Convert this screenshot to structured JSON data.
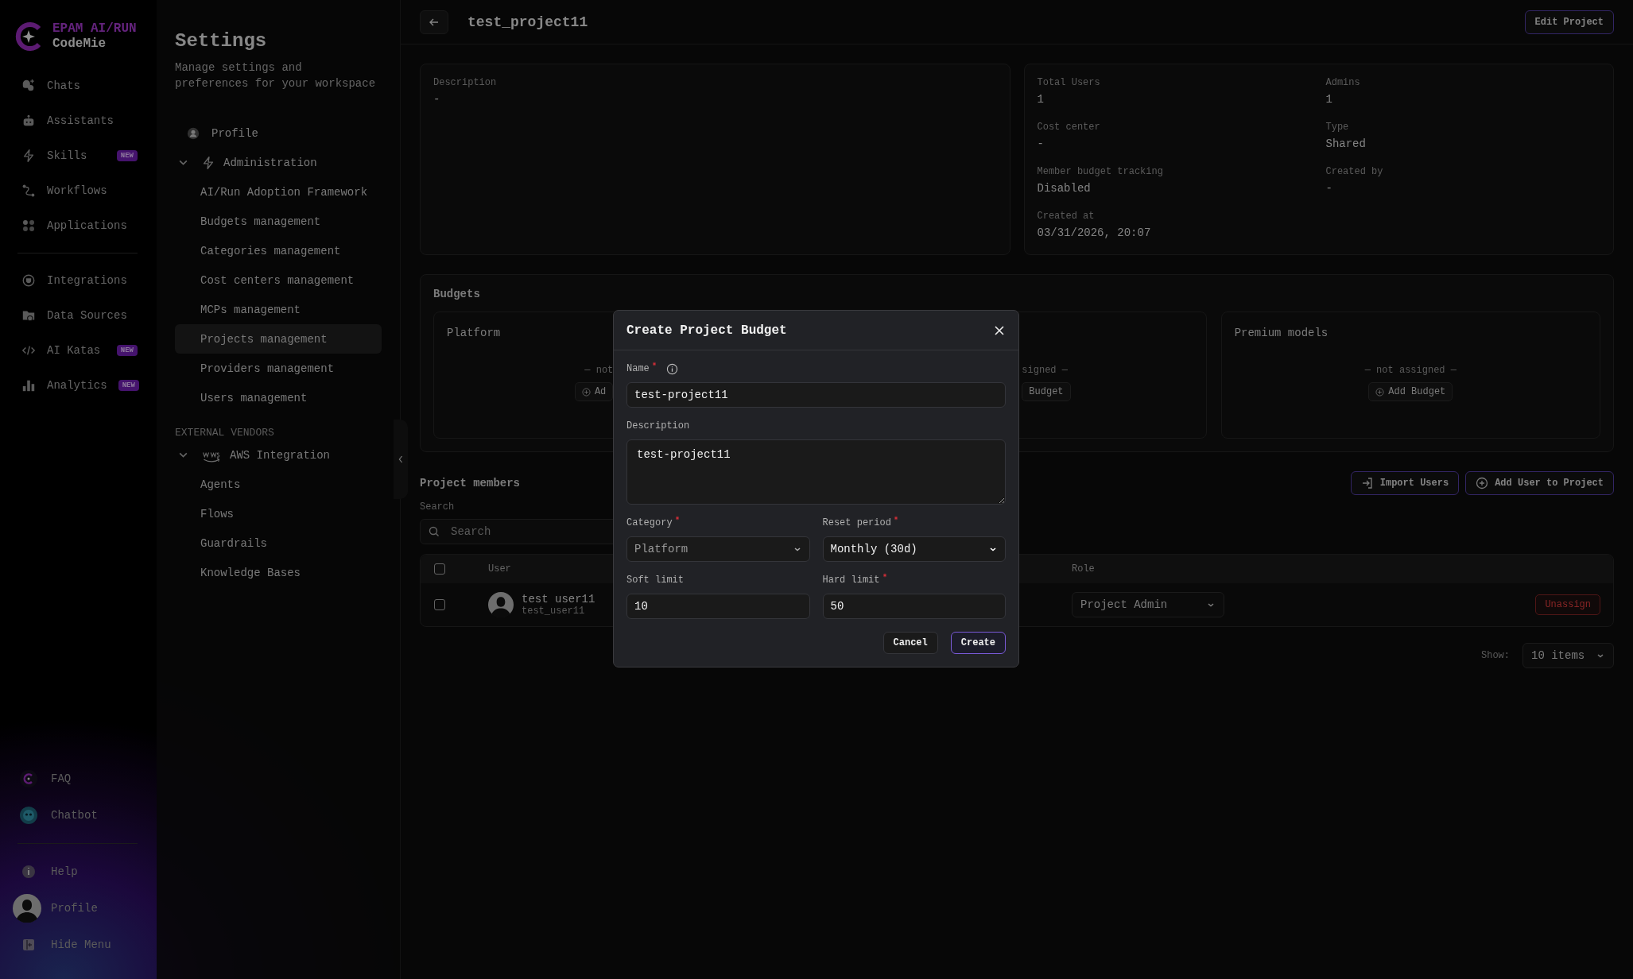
{
  "brand": {
    "line1": "EPAM AI/RUN",
    "line2": "CodeMie"
  },
  "nav": {
    "primary": [
      {
        "label": "Chats"
      },
      {
        "label": "Assistants"
      },
      {
        "label": "Skills",
        "badge": "NEW"
      },
      {
        "label": "Workflows"
      },
      {
        "label": "Applications"
      }
    ],
    "secondary": [
      {
        "label": "Integrations"
      },
      {
        "label": "Data Sources"
      },
      {
        "label": "AI Katas",
        "badge": "NEW"
      },
      {
        "label": "Analytics",
        "badge": "NEW"
      }
    ],
    "support": [
      {
        "label": "FAQ"
      },
      {
        "label": "Chatbot"
      }
    ],
    "footer": [
      {
        "label": "Help"
      },
      {
        "label": "Profile"
      },
      {
        "label": "Hide Menu"
      }
    ]
  },
  "settings": {
    "title": "Settings",
    "subtitle": "Manage settings and preferences for your workspace",
    "profile": "Profile",
    "admin": {
      "label": "Administration",
      "expanded": true,
      "children": [
        {
          "label": "AI/Run Adoption Framework",
          "selected": false
        },
        {
          "label": "Budgets management",
          "selected": false
        },
        {
          "label": "Categories management",
          "selected": false
        },
        {
          "label": "Cost centers management",
          "selected": false
        },
        {
          "label": "MCPs management",
          "selected": false
        },
        {
          "label": "Projects management",
          "selected": true
        },
        {
          "label": "Providers management",
          "selected": false
        },
        {
          "label": "Users management",
          "selected": false
        }
      ]
    },
    "vendors_heading": "EXTERNAL VENDORS",
    "aws": {
      "label": "AWS Integration",
      "expanded": true,
      "children": [
        {
          "label": "Agents",
          "selected": false
        },
        {
          "label": "Flows",
          "selected": false
        },
        {
          "label": "Guardrails",
          "selected": false
        },
        {
          "label": "Knowledge Bases",
          "selected": false
        }
      ]
    }
  },
  "header": {
    "title": "test_project11",
    "edit_button": "Edit Project"
  },
  "description": {
    "label": "Description",
    "value": "-"
  },
  "stats": [
    {
      "label": "Total Users",
      "value": "1"
    },
    {
      "label": "Admins",
      "value": "1"
    },
    {
      "label": "Cost center",
      "value": "-"
    },
    {
      "label": "Type",
      "value": "Shared"
    },
    {
      "label": "Member budget tracking",
      "value": "Disabled"
    },
    {
      "label": "Created by",
      "value": "-"
    },
    {
      "label": "Created at",
      "value": "03/31/2026, 20:07"
    }
  ],
  "budgets": {
    "title": "Budgets",
    "cards": [
      {
        "title": "Platform",
        "status": "— not",
        "button": "Ad"
      },
      {
        "status": "signed —",
        "button": "Budget"
      },
      {
        "title": "Premium models",
        "status": "— not assigned —",
        "button": "Add Budget"
      }
    ]
  },
  "members": {
    "title": "Project members",
    "import_button": "Import Users",
    "add_button": "Add User to Project",
    "search_label": "Search",
    "search_placeholder": "Search",
    "columns": [
      "User",
      "Role"
    ],
    "select_all": false,
    "rows": [
      {
        "checked": false,
        "name": "test user11",
        "username": "test_user11",
        "role": "Project Admin",
        "action": "Unassign"
      }
    ],
    "page_size_label": "Show:",
    "page_size": "10 items"
  },
  "modal": {
    "title": "Create Project Budget",
    "fields": [
      {
        "kind": "text",
        "label": "Name",
        "required": true,
        "info": true,
        "value": "test-project11",
        "disabled": false
      },
      {
        "kind": "textarea",
        "label": "Description",
        "required": false,
        "info": false,
        "value": "test-project11",
        "disabled": false
      },
      {
        "kind": "select",
        "label": "Category",
        "required": true,
        "info": false,
        "value": "Platform",
        "disabled": true
      },
      {
        "kind": "select",
        "label": "Reset period",
        "required": true,
        "info": false,
        "value": "Monthly (30d)",
        "disabled": false
      },
      {
        "kind": "text",
        "label": "Soft limit",
        "required": false,
        "info": false,
        "value": "10",
        "disabled": false
      },
      {
        "kind": "text",
        "label": "Hard limit",
        "required": true,
        "info": false,
        "value": "50",
        "disabled": false
      }
    ],
    "cancel": "Cancel",
    "create": "Create"
  }
}
